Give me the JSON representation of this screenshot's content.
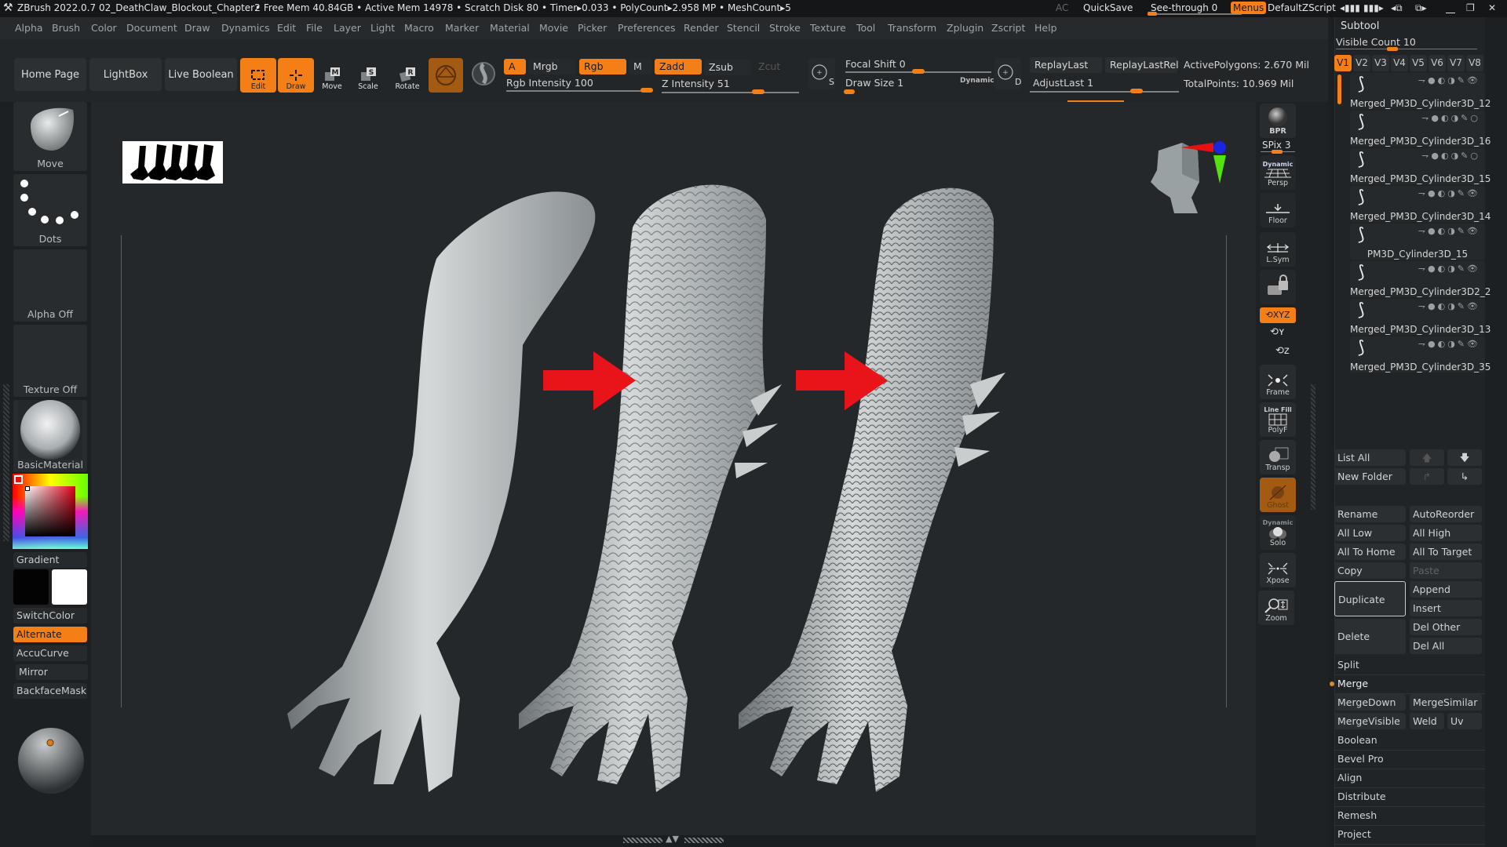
{
  "titlebar": {
    "app": "ZBrush 2022.0.7",
    "document": "02_DeathClaw_Blockout_Chapter2",
    "stats": "• Free Mem 40.84GB • Active Mem 14978 • Scratch Disk 80 •  Timer▸0.033 • PolyCount▸2.958 MP  • MeshCount▸5",
    "ac": "AC",
    "quicksave": "QuickSave",
    "seethrough": "See-through  0",
    "seethrough_value": 0,
    "menus": "Menus",
    "script": "DefaultZScript"
  },
  "menubar": [
    "Alpha",
    "Brush",
    "Color",
    "Document",
    "Draw",
    "Dynamics",
    "Edit",
    "File",
    "Layer",
    "Light",
    "Macro",
    "Marker",
    "Material",
    "Movie",
    "Picker",
    "Preferences",
    "Render",
    "Stencil",
    "Stroke",
    "Texture",
    "Tool",
    "Transform",
    "Zplugin",
    "Zscript",
    "Help"
  ],
  "toolbar": {
    "home_page": "Home Page",
    "lightbox": "LightBox",
    "live_boolean": "Live Boolean",
    "edit": "Edit",
    "draw": "Draw",
    "move": "Move",
    "scale": "Scale",
    "rotate": "Rotate",
    "a": "A",
    "mrgb": "Mrgb",
    "rgb": "Rgb",
    "m": "M",
    "zadd": "Zadd",
    "zsub": "Zsub",
    "zcut": "Zcut",
    "rgb_intensity": "Rgb Intensity 100",
    "z_intensity": "Z Intensity 51",
    "focal_shift": "Focal Shift 0",
    "draw_size": "Draw Size 1",
    "dynamic": "Dynamic",
    "s_label": "S",
    "d_label": "D",
    "replay_last": "ReplayLast",
    "replay_last_rel": "ReplayLastRel",
    "adjust_last": "AdjustLast 1",
    "active_polygons": "ActivePolygons: 2.670 Mil",
    "total_points": "TotalPoints: 10.969 Mil"
  },
  "leftpanel": {
    "brush": "Move",
    "stroke": "Dots",
    "alpha": "Alpha Off",
    "texture": "Texture Off",
    "material": "BasicMaterial",
    "gradient": "Gradient",
    "switch_color": "SwitchColor",
    "alternate": "Alternate",
    "accucurve": "AccuCurve",
    "mirror": "Mirror",
    "backface_mask": "BackfaceMask",
    "main_color": "#000000",
    "secondary_color": "#ffffff"
  },
  "righttools": {
    "bpr": "BPR",
    "spix": "SPix 3",
    "persp_top": "Dynamic",
    "persp": "Persp",
    "floor": "Floor",
    "lsym": "L.Sym",
    "xyz": "XYZ",
    "frame": "Frame",
    "polyf_top": "Line Fill",
    "polyf": "PolyF",
    "transp": "Transp",
    "ghost": "Ghost",
    "solo_top": "Dynamic",
    "solo": "Solo",
    "xpose": "Xpose",
    "zoom": "Zoom"
  },
  "subtool": {
    "title": "Subtool",
    "visible_count": "Visible Count 10",
    "visible_count_value": 10,
    "tabs": [
      "V1",
      "V2",
      "V3",
      "V4",
      "V5",
      "V6",
      "V7",
      "V8"
    ],
    "items": [
      {
        "name": "Merged_PM3D_Cylinder3D_12",
        "visible": true
      },
      {
        "name": "Merged_PM3D_Cylinder3D_16",
        "visible": false
      },
      {
        "name": "Merged_PM3D_Cylinder3D_15",
        "visible": false
      },
      {
        "name": "Merged_PM3D_Cylinder3D_14",
        "visible": true
      },
      {
        "name": "PM3D_Cylinder3D_15",
        "visible": true
      },
      {
        "name": "Merged_PM3D_Cylinder3D2_2",
        "visible": true
      },
      {
        "name": "Merged_PM3D_Cylinder3D_13",
        "visible": true
      },
      {
        "name": "Merged_PM3D_Cylinder3D_35",
        "visible": true
      }
    ],
    "list_all": "List All",
    "new_folder": "New Folder",
    "rename": "Rename",
    "auto_reorder": "AutoReorder",
    "all_low": "All Low",
    "all_high": "All High",
    "all_to_home": "All To Home",
    "all_to_target": "All To Target",
    "copy": "Copy",
    "paste": "Paste",
    "duplicate": "Duplicate",
    "append": "Append",
    "insert": "Insert",
    "delete": "Delete",
    "del_other": "Del Other",
    "del_all": "Del All",
    "split": "Split",
    "merge": "Merge",
    "merge_down": "MergeDown",
    "merge_similar": "MergeSimilar",
    "merge_visible": "MergeVisible",
    "weld": "Weld",
    "uv": "Uv",
    "boolean": "Boolean",
    "bevel_pro": "Bevel Pro",
    "align": "Align",
    "distribute": "Distribute",
    "remesh": "Remesh",
    "project": "Project"
  },
  "colors": {
    "accent": "#f57f17",
    "arrow": "#e8141a"
  }
}
